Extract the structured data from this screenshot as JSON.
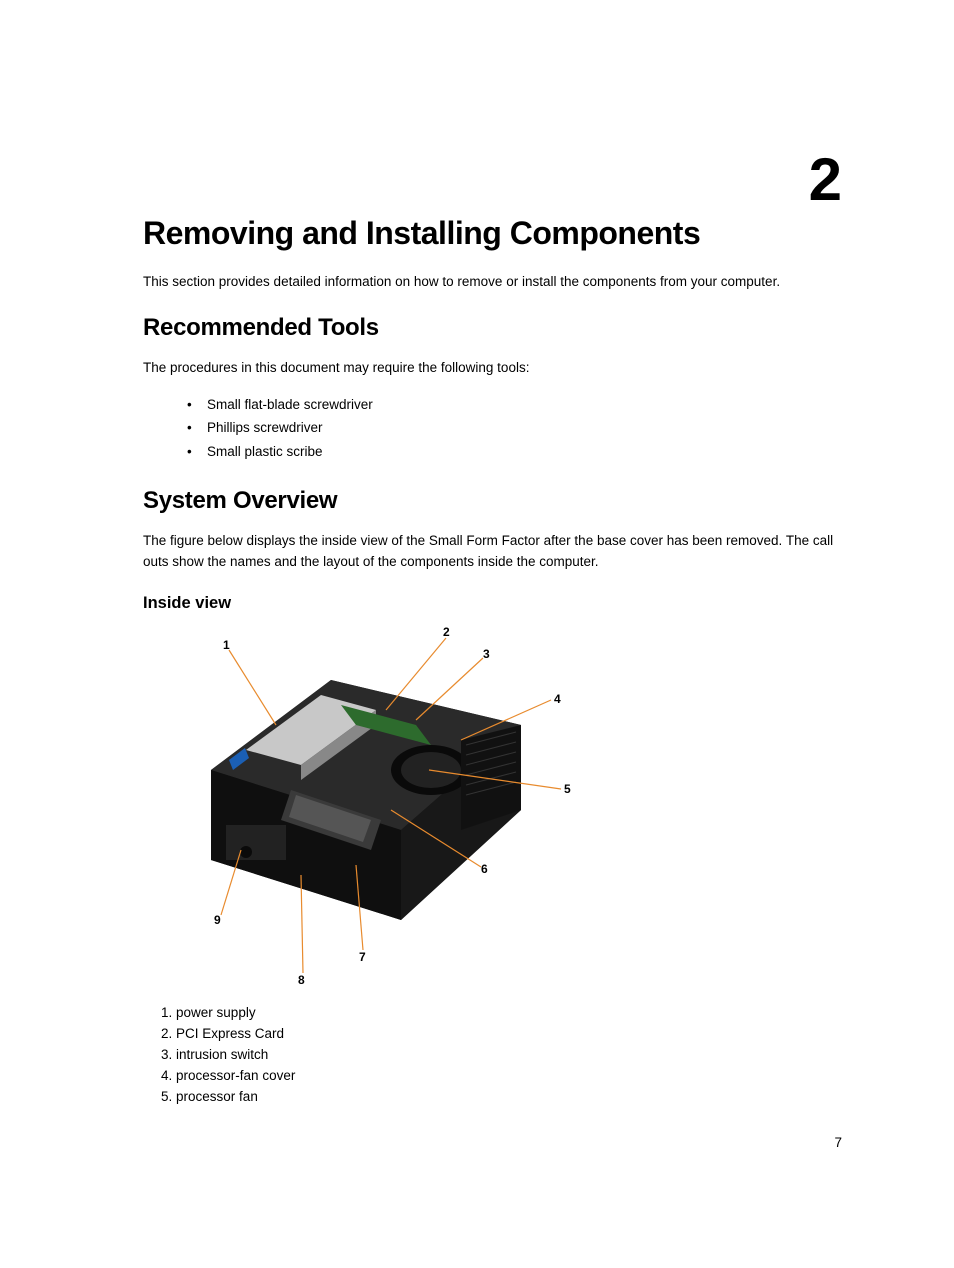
{
  "chapter_number": "2",
  "title": "Removing and Installing Components",
  "intro_text": "This section provides detailed information on how to remove or install the components from your computer.",
  "section_tools": {
    "heading": "Recommended Tools",
    "text": "The procedures in this document may require the following tools:",
    "items": [
      "Small flat-blade screwdriver",
      "Phillips screwdriver",
      "Small plastic scribe"
    ]
  },
  "section_overview": {
    "heading": "System Overview",
    "text": "The figure below displays the inside view of the Small Form Factor after the base cover has been removed. The call outs show the names and the layout of the components inside the computer.",
    "subheading": "Inside view"
  },
  "figure": {
    "callout_numbers": [
      "1",
      "2",
      "3",
      "4",
      "5",
      "6",
      "7",
      "8",
      "9"
    ],
    "callout_items": [
      "power supply",
      "PCI Express Card",
      "intrusion switch",
      "processor-fan cover",
      "processor fan"
    ]
  },
  "page_number": "7"
}
